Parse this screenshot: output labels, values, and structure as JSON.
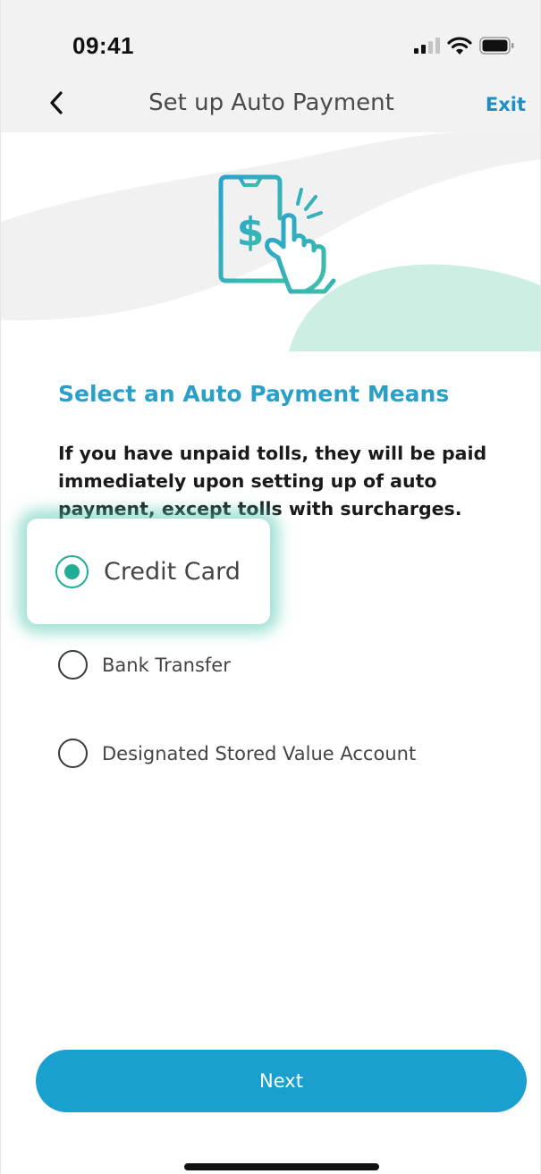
{
  "status_bar": {
    "time": "09:41",
    "icons": [
      "signal-icon",
      "wifi-icon",
      "battery-icon"
    ]
  },
  "nav": {
    "title": "Set up Auto Payment",
    "back_icon": "chevron-left-icon",
    "exit_label": "Exit"
  },
  "hero": {
    "icon": "phone-payment-tap-icon"
  },
  "content": {
    "heading": "Select an Auto Payment Means",
    "description": "If you have unpaid tolls, they will be paid immediately upon setting up of auto payment, except tolls with surcharges."
  },
  "options": [
    {
      "label": "Credit Card",
      "selected": true
    },
    {
      "label": "Bank Transfer",
      "selected": false
    },
    {
      "label": "Designated Stored Value Account",
      "selected": false
    }
  ],
  "next_label": "Next",
  "colors": {
    "accent": "#1aa0cf",
    "heading": "#2a9fc7",
    "selected": "#1fae94",
    "exit": "#1d8fc4",
    "hero_arc": "#cdeee3",
    "hero_wave": "#f0f0f0"
  }
}
